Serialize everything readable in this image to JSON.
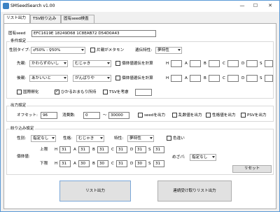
{
  "window": {
    "title": "SMSeedSearch v1.00",
    "minimize": "—",
    "maximize": "☐",
    "close": "✕"
  },
  "tabs": [
    "リスト出力",
    "TSV絞り込み",
    "固有seed検査"
  ],
  "seed": {
    "label": "固有seed",
    "value": "EFC1619E 18249D68 1C8EAB72 D54D0A43"
  },
  "conditions": {
    "title": "条件設定",
    "gender_type_label": "性別タイプ:",
    "gender_type_value": "♂50% : ♀50%",
    "female_ditto_label": "片親がメタモン",
    "inherit_label": "遺伝特性:",
    "inherit_value": "夢特性",
    "lead_label": "先親:",
    "lead_item": "かわらずのいし",
    "lead_nature": "むじゃき",
    "lead_calc_label": "個体値遺伝を計算",
    "lead_stats": [
      "H",
      "A",
      "B",
      "C",
      "D",
      "S"
    ],
    "follow_label": "後親:",
    "follow_item": "あかいいと",
    "follow_nature": "がんばりや",
    "follow_calc_label": "個体値遺伝を計算",
    "follow_stats": [
      "H",
      "A",
      "B",
      "C",
      "D",
      "S"
    ],
    "international_label": "国際孵化",
    "charm_label": "ひかるおまもり所持",
    "tsv_label": "TSVを考慮"
  },
  "output": {
    "title": "出力設定",
    "offset_label": "オフセット:",
    "offset_value": "96",
    "consume_label": "消費数:",
    "consume_from": "0",
    "tilde": "〜",
    "consume_to": "30000",
    "seed_output_label": "seedを出力",
    "rand_output_label": "乱数値を出力",
    "ivs_output_label": "性格値を出力",
    "psv_output_label": "PSVを出力"
  },
  "filter": {
    "title": "絞り込み設定",
    "gender_label": "性別:",
    "gender_value": "指定なし",
    "nature_label": "性格:",
    "nature_value": "むじゃき",
    "ability_label": "特性:",
    "ability_value": "夢特性",
    "color_label": "色違い",
    "ivs_label": "個体値:",
    "upper_label": "上限",
    "lower_label": "下限",
    "upper_stats": [
      {
        "k": "H",
        "v": "31"
      },
      {
        "k": "A",
        "v": "31"
      },
      {
        "k": "B",
        "v": "31"
      },
      {
        "k": "C",
        "v": "31"
      },
      {
        "k": "D",
        "v": "31"
      },
      {
        "k": "S",
        "v": "31"
      }
    ],
    "lower_stats": [
      {
        "k": "H",
        "v": "31"
      },
      {
        "k": "A",
        "v": "30"
      },
      {
        "k": "B",
        "v": "30"
      },
      {
        "k": "C",
        "v": "31"
      },
      {
        "k": "D",
        "v": "30"
      },
      {
        "k": "S",
        "v": "31"
      }
    ],
    "mezapa_label": "めざパ:",
    "mezapa_value": "指定なし",
    "reset_label": "リセット"
  },
  "buttons": {
    "list_output": "リスト出力",
    "consecutive_output": "連続受け取りリスト出力"
  }
}
